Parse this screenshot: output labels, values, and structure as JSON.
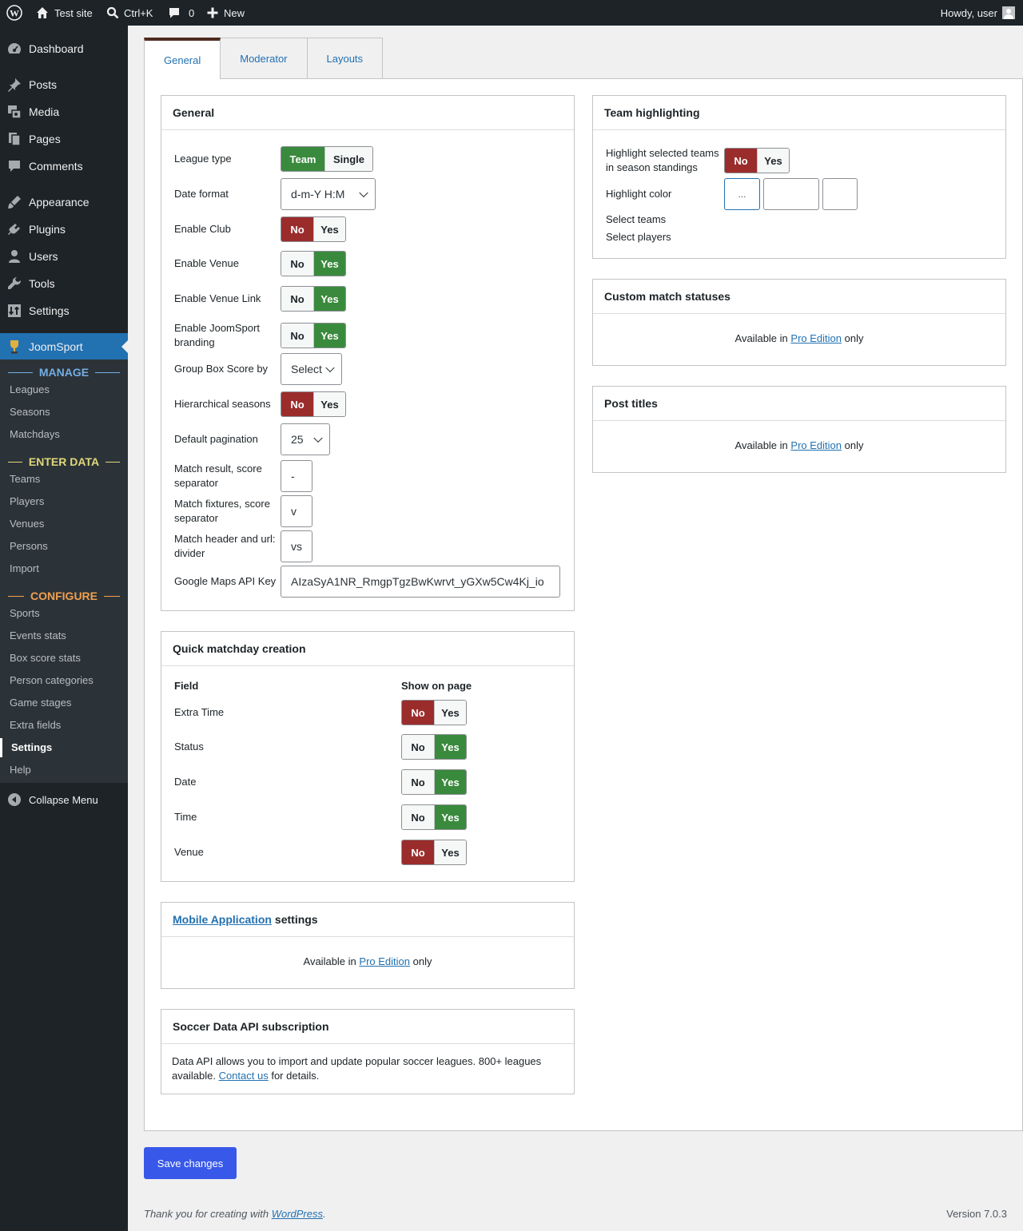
{
  "adminbar": {
    "site_name": "Test site",
    "search_label": "Ctrl+K",
    "comments_count": "0",
    "new_label": "New",
    "howdy": "Howdy, user"
  },
  "sidebar": {
    "items": [
      {
        "label": "Dashboard",
        "icon": "dashboard-icon"
      },
      {
        "label": "Posts",
        "icon": "pin-icon"
      },
      {
        "label": "Media",
        "icon": "media-icon"
      },
      {
        "label": "Pages",
        "icon": "pages-icon"
      },
      {
        "label": "Comments",
        "icon": "comments-icon"
      },
      {
        "label": "Appearance",
        "icon": "brush-icon"
      },
      {
        "label": "Plugins",
        "icon": "plug-icon"
      },
      {
        "label": "Users",
        "icon": "user-icon"
      },
      {
        "label": "Tools",
        "icon": "wrench-icon"
      },
      {
        "label": "Settings",
        "icon": "sliders-icon"
      },
      {
        "label": "JoomSport",
        "icon": "trophy-icon"
      }
    ],
    "manage_header": "MANAGE",
    "manage_items": [
      "Leagues",
      "Seasons",
      "Matchdays"
    ],
    "enter_header": "ENTER DATA",
    "enter_items": [
      "Teams",
      "Players",
      "Venues",
      "Persons",
      "Import"
    ],
    "configure_header": "CONFIGURE",
    "configure_items": [
      "Sports",
      "Events stats",
      "Box score stats",
      "Person categories",
      "Game stages",
      "Extra fields",
      "Settings",
      "Help"
    ],
    "collapse_label": "Collapse Menu",
    "colors": {
      "manage": "#72aee6",
      "enter": "#e0d87a",
      "configure": "#f0a050",
      "active": "#2271b1"
    }
  },
  "tabs": [
    "General",
    "Moderator",
    "Layouts"
  ],
  "general": {
    "title": "General",
    "league_type": {
      "label": "League type",
      "options": [
        "Team",
        "Single"
      ],
      "selected": "Team"
    },
    "date_format": {
      "label": "Date format",
      "value": "d-m-Y H:M"
    },
    "enable_club": {
      "label": "Enable Club",
      "value": "No"
    },
    "enable_venue": {
      "label": "Enable Venue",
      "value": "Yes"
    },
    "enable_venue_link": {
      "label": "Enable Venue Link",
      "value": "Yes"
    },
    "enable_branding": {
      "label": "Enable JoomSport branding",
      "value": "Yes"
    },
    "group_box_score": {
      "label": "Group Box Score by",
      "value": "Select"
    },
    "hierarchical": {
      "label": "Hierarchical seasons",
      "value": "No"
    },
    "pagination": {
      "label": "Default pagination",
      "value": "25"
    },
    "result_sep": {
      "label": "Match result, score separator",
      "value": "-"
    },
    "fixtures_sep": {
      "label": "Match fixtures, score separator",
      "value": "v"
    },
    "header_divider": {
      "label": "Match header and url: divider",
      "value": "vs"
    },
    "maps_key": {
      "label": "Google Maps API Key",
      "value": "AIzaSyA1NR_RmgpTgzBwKwrvt_yGXw5Cw4Kj_io"
    }
  },
  "yes_no": {
    "no": "No",
    "yes": "Yes"
  },
  "quick": {
    "title": "Quick matchday creation",
    "col_field": "Field",
    "col_show": "Show on page",
    "rows": [
      {
        "label": "Extra Time",
        "value": "No"
      },
      {
        "label": "Status",
        "value": "Yes"
      },
      {
        "label": "Date",
        "value": "Yes"
      },
      {
        "label": "Time",
        "value": "Yes"
      },
      {
        "label": "Venue",
        "value": "No"
      }
    ]
  },
  "mobile": {
    "title_link": "Mobile Application",
    "title_rest": "settings"
  },
  "pro": {
    "prefix": "Available in",
    "link": "Pro Edition",
    "suffix": "only"
  },
  "soccer": {
    "title": "Soccer Data API subscription",
    "text": "Data API allows you to import and update popular soccer leagues. 800+ leagues available.",
    "link": "Contact us",
    "suffix": "for details."
  },
  "team_highlight": {
    "title": "Team highlighting",
    "highlight_label": "Highlight selected teams in season standings",
    "highlight_value": "No",
    "color_label": "Highlight color",
    "color_button": "...",
    "select_teams": "Select teams",
    "select_players": "Select players"
  },
  "custom_statuses": {
    "title": "Custom match statuses"
  },
  "post_titles": {
    "title": "Post titles"
  },
  "save_label": "Save changes",
  "footer": {
    "thanks_prefix": "Thank you for creating with",
    "wp_link": "WordPress",
    "version": "Version 7.0.3"
  }
}
